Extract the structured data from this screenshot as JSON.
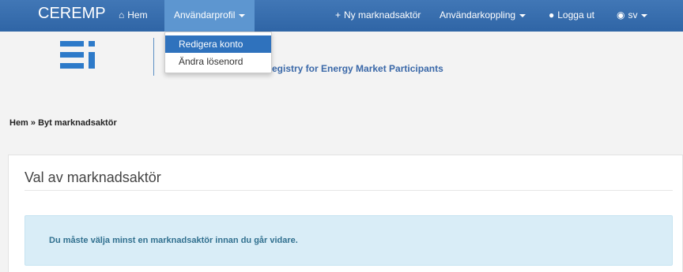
{
  "navbar": {
    "brand": "CEREMP",
    "home": "Hem",
    "user_profile": "Användarprofil",
    "new_participant": "Ny marknadsaktör",
    "user_link": "Användarkoppling",
    "logout": "Logga ut",
    "language": "sv"
  },
  "dropdown": {
    "items": [
      "Redigera konto",
      "Ändra lösenord"
    ]
  },
  "header": {
    "tagline": "egistry for Energy Market Participants"
  },
  "breadcrumb": "Hem » Byt marknadsaktör",
  "panel": {
    "title": "Val av marknadsaktör",
    "alert": "Du måste välja minst en marknadsaktör innan du går vidare."
  },
  "colors": {
    "navbar": "#2f65a6",
    "accent": "#2f72bd",
    "alert_bg": "#d9edf7",
    "alert_text": "#31708f"
  }
}
